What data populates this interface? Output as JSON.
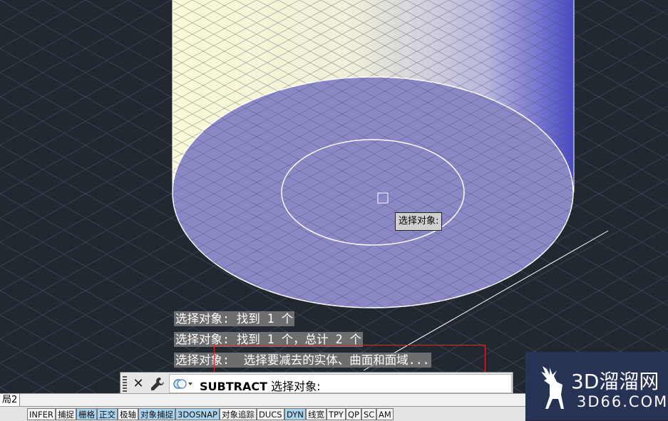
{
  "viewport": {
    "tooltip": "选择对象:"
  },
  "command_history": [
    "选择对象: 找到 1 个",
    "选择对象: 找到 1 个，总计 2 个",
    "选择对象:  选择要减去的实体、曲面和面域..."
  ],
  "command_line": {
    "close_label": "✕",
    "command": "SUBTRACT",
    "prompt": " 选择对象:"
  },
  "layout_tab": "局2",
  "status_buttons": [
    {
      "label": "INFER",
      "on": false
    },
    {
      "label": "捕捉",
      "on": false
    },
    {
      "label": "栅格",
      "on": true
    },
    {
      "label": "正交",
      "on": true
    },
    {
      "label": "极轴",
      "on": false
    },
    {
      "label": "对象捕捉",
      "on": true
    },
    {
      "label": "3DOSNAP",
      "on": true
    },
    {
      "label": "对象追踪",
      "on": false
    },
    {
      "label": "DUCS",
      "on": false
    },
    {
      "label": "DYN",
      "on": true
    },
    {
      "label": "线宽",
      "on": false
    },
    {
      "label": "TPY",
      "on": false
    },
    {
      "label": "QP",
      "on": false
    },
    {
      "label": "SC",
      "on": false
    },
    {
      "label": "AM",
      "on": false
    }
  ],
  "watermark": {
    "name": "3D溜溜网",
    "domain": "3D66.COM"
  },
  "colors": {
    "background": "#212830",
    "solid_face": "#8a88c6",
    "status_on": "#a8d4ef",
    "highlight_box": "#e22a2a"
  }
}
